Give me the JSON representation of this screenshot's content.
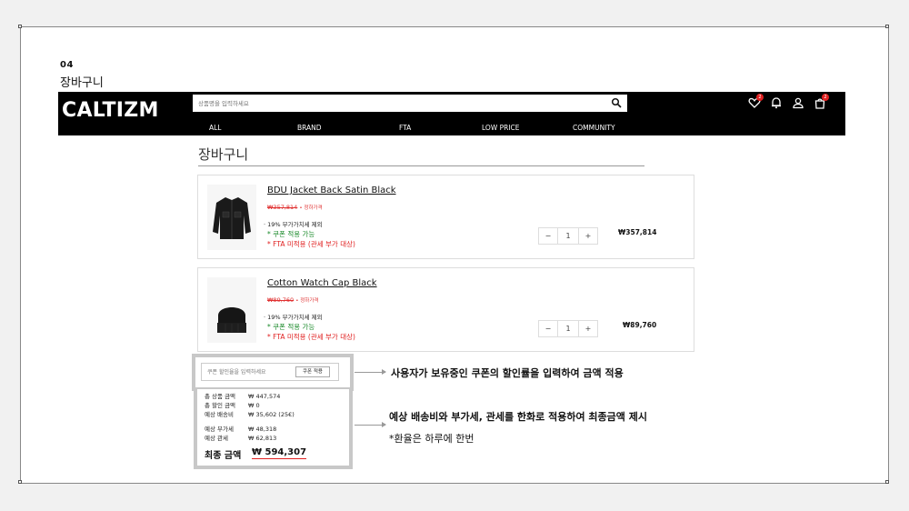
{
  "section": {
    "number": "04",
    "title": "장바구니"
  },
  "header": {
    "logo": "CALTIZM",
    "search_placeholder": "상품명을 입력하세요",
    "menu": [
      "ALL",
      "BRAND",
      "FTA",
      "LOW PRICE",
      "COMMUNITY"
    ],
    "wishlist_count": "2",
    "cart_count": "2"
  },
  "cart": {
    "title": "장바구니",
    "items": [
      {
        "name": "BDU Jacket Back Satin Black",
        "original_price": "₩357,814",
        "original_tag": "• 정하가격",
        "vat": "19% 부가가치세 제외",
        "coupon_note": "* 쿠폰 적용 가능",
        "fta_note": "* FTA 미적용 (관세 부가 대상)",
        "quantity": "1",
        "price": "₩357,814",
        "minus": "−",
        "plus": "+",
        "image_icon": "jacket-icon"
      },
      {
        "name": "Cotton Watch Cap Black",
        "original_price": "₩89,760",
        "original_tag": "• 정하가격",
        "vat": "19% 부가가치세 제외",
        "coupon_note": "* 쿠폰 적용 가능",
        "fta_note": "* FTA 미적용 (관세 부가 대상)",
        "quantity": "1",
        "price": "₩89,760",
        "minus": "−",
        "plus": "+",
        "image_icon": "beanie-icon"
      }
    ]
  },
  "coupon": {
    "placeholder": "쿠폰 할인율을 입력하세요",
    "button": "쿠폰 적용"
  },
  "summary": {
    "rows": [
      {
        "label": "총 상품 금액",
        "value": "₩ 447,574"
      },
      {
        "label": "총 할인 금액",
        "value": "₩ 0"
      },
      {
        "label": "예상 배송비",
        "value": "₩ 35,602 (25€)"
      },
      {
        "label": "예상 부가세",
        "value": "₩ 48,318"
      },
      {
        "label": "예상 관세",
        "value": "₩ 62,813"
      }
    ],
    "final_label": "최종 금액",
    "final_value": "₩ 594,307"
  },
  "annotations": {
    "coupon": "사용자가 보유중인 쿠폰의 할인률을 입력하여 금액 적용",
    "summary": "예상 배송비와 부가세, 관세를 한화로 적용하여 최종금액 제시",
    "summary_note": "*환율은 하루에 한번"
  },
  "colors": {
    "nav_bg": "#000000",
    "discount_red": "#e03030",
    "coupon_green": "#1a8a2a",
    "badge_red": "#e02020"
  }
}
